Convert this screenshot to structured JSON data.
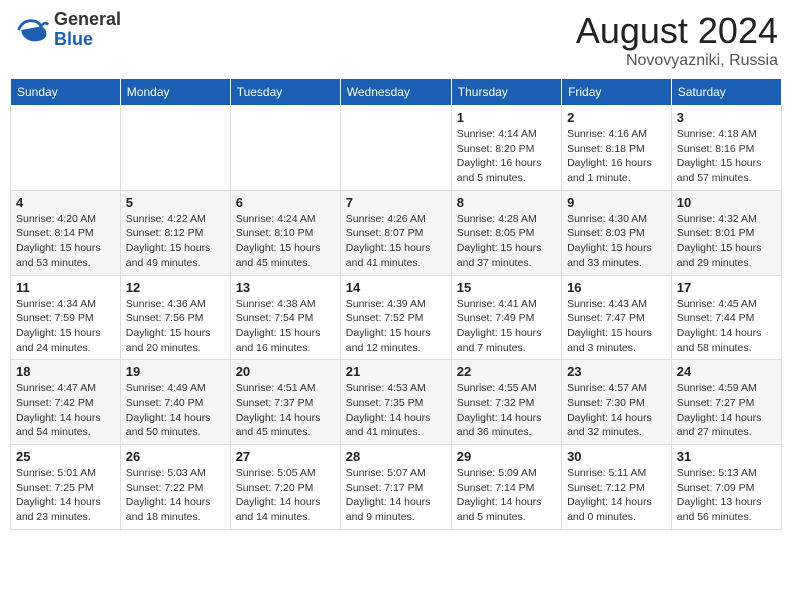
{
  "header": {
    "logo_general": "General",
    "logo_blue": "Blue",
    "month": "August 2024",
    "location": "Novovyazniki, Russia"
  },
  "weekdays": [
    "Sunday",
    "Monday",
    "Tuesday",
    "Wednesday",
    "Thursday",
    "Friday",
    "Saturday"
  ],
  "weeks": [
    [
      null,
      null,
      null,
      null,
      {
        "day": "1",
        "sunrise": "4:14 AM",
        "sunset": "8:20 PM",
        "daylight": "16 hours and 5 minutes."
      },
      {
        "day": "2",
        "sunrise": "4:16 AM",
        "sunset": "8:18 PM",
        "daylight": "16 hours and 1 minute."
      },
      {
        "day": "3",
        "sunrise": "4:18 AM",
        "sunset": "8:16 PM",
        "daylight": "15 hours and 57 minutes."
      }
    ],
    [
      {
        "day": "4",
        "sunrise": "4:20 AM",
        "sunset": "8:14 PM",
        "daylight": "15 hours and 53 minutes."
      },
      {
        "day": "5",
        "sunrise": "4:22 AM",
        "sunset": "8:12 PM",
        "daylight": "15 hours and 49 minutes."
      },
      {
        "day": "6",
        "sunrise": "4:24 AM",
        "sunset": "8:10 PM",
        "daylight": "15 hours and 45 minutes."
      },
      {
        "day": "7",
        "sunrise": "4:26 AM",
        "sunset": "8:07 PM",
        "daylight": "15 hours and 41 minutes."
      },
      {
        "day": "8",
        "sunrise": "4:28 AM",
        "sunset": "8:05 PM",
        "daylight": "15 hours and 37 minutes."
      },
      {
        "day": "9",
        "sunrise": "4:30 AM",
        "sunset": "8:03 PM",
        "daylight": "15 hours and 33 minutes."
      },
      {
        "day": "10",
        "sunrise": "4:32 AM",
        "sunset": "8:01 PM",
        "daylight": "15 hours and 29 minutes."
      }
    ],
    [
      {
        "day": "11",
        "sunrise": "4:34 AM",
        "sunset": "7:59 PM",
        "daylight": "15 hours and 24 minutes."
      },
      {
        "day": "12",
        "sunrise": "4:36 AM",
        "sunset": "7:56 PM",
        "daylight": "15 hours and 20 minutes."
      },
      {
        "day": "13",
        "sunrise": "4:38 AM",
        "sunset": "7:54 PM",
        "daylight": "15 hours and 16 minutes."
      },
      {
        "day": "14",
        "sunrise": "4:39 AM",
        "sunset": "7:52 PM",
        "daylight": "15 hours and 12 minutes."
      },
      {
        "day": "15",
        "sunrise": "4:41 AM",
        "sunset": "7:49 PM",
        "daylight": "15 hours and 7 minutes."
      },
      {
        "day": "16",
        "sunrise": "4:43 AM",
        "sunset": "7:47 PM",
        "daylight": "15 hours and 3 minutes."
      },
      {
        "day": "17",
        "sunrise": "4:45 AM",
        "sunset": "7:44 PM",
        "daylight": "14 hours and 58 minutes."
      }
    ],
    [
      {
        "day": "18",
        "sunrise": "4:47 AM",
        "sunset": "7:42 PM",
        "daylight": "14 hours and 54 minutes."
      },
      {
        "day": "19",
        "sunrise": "4:49 AM",
        "sunset": "7:40 PM",
        "daylight": "14 hours and 50 minutes."
      },
      {
        "day": "20",
        "sunrise": "4:51 AM",
        "sunset": "7:37 PM",
        "daylight": "14 hours and 45 minutes."
      },
      {
        "day": "21",
        "sunrise": "4:53 AM",
        "sunset": "7:35 PM",
        "daylight": "14 hours and 41 minutes."
      },
      {
        "day": "22",
        "sunrise": "4:55 AM",
        "sunset": "7:32 PM",
        "daylight": "14 hours and 36 minutes."
      },
      {
        "day": "23",
        "sunrise": "4:57 AM",
        "sunset": "7:30 PM",
        "daylight": "14 hours and 32 minutes."
      },
      {
        "day": "24",
        "sunrise": "4:59 AM",
        "sunset": "7:27 PM",
        "daylight": "14 hours and 27 minutes."
      }
    ],
    [
      {
        "day": "25",
        "sunrise": "5:01 AM",
        "sunset": "7:25 PM",
        "daylight": "14 hours and 23 minutes."
      },
      {
        "day": "26",
        "sunrise": "5:03 AM",
        "sunset": "7:22 PM",
        "daylight": "14 hours and 18 minutes."
      },
      {
        "day": "27",
        "sunrise": "5:05 AM",
        "sunset": "7:20 PM",
        "daylight": "14 hours and 14 minutes."
      },
      {
        "day": "28",
        "sunrise": "5:07 AM",
        "sunset": "7:17 PM",
        "daylight": "14 hours and 9 minutes."
      },
      {
        "day": "29",
        "sunrise": "5:09 AM",
        "sunset": "7:14 PM",
        "daylight": "14 hours and 5 minutes."
      },
      {
        "day": "30",
        "sunrise": "5:11 AM",
        "sunset": "7:12 PM",
        "daylight": "14 hours and 0 minutes."
      },
      {
        "day": "31",
        "sunrise": "5:13 AM",
        "sunset": "7:09 PM",
        "daylight": "13 hours and 56 minutes."
      }
    ]
  ]
}
